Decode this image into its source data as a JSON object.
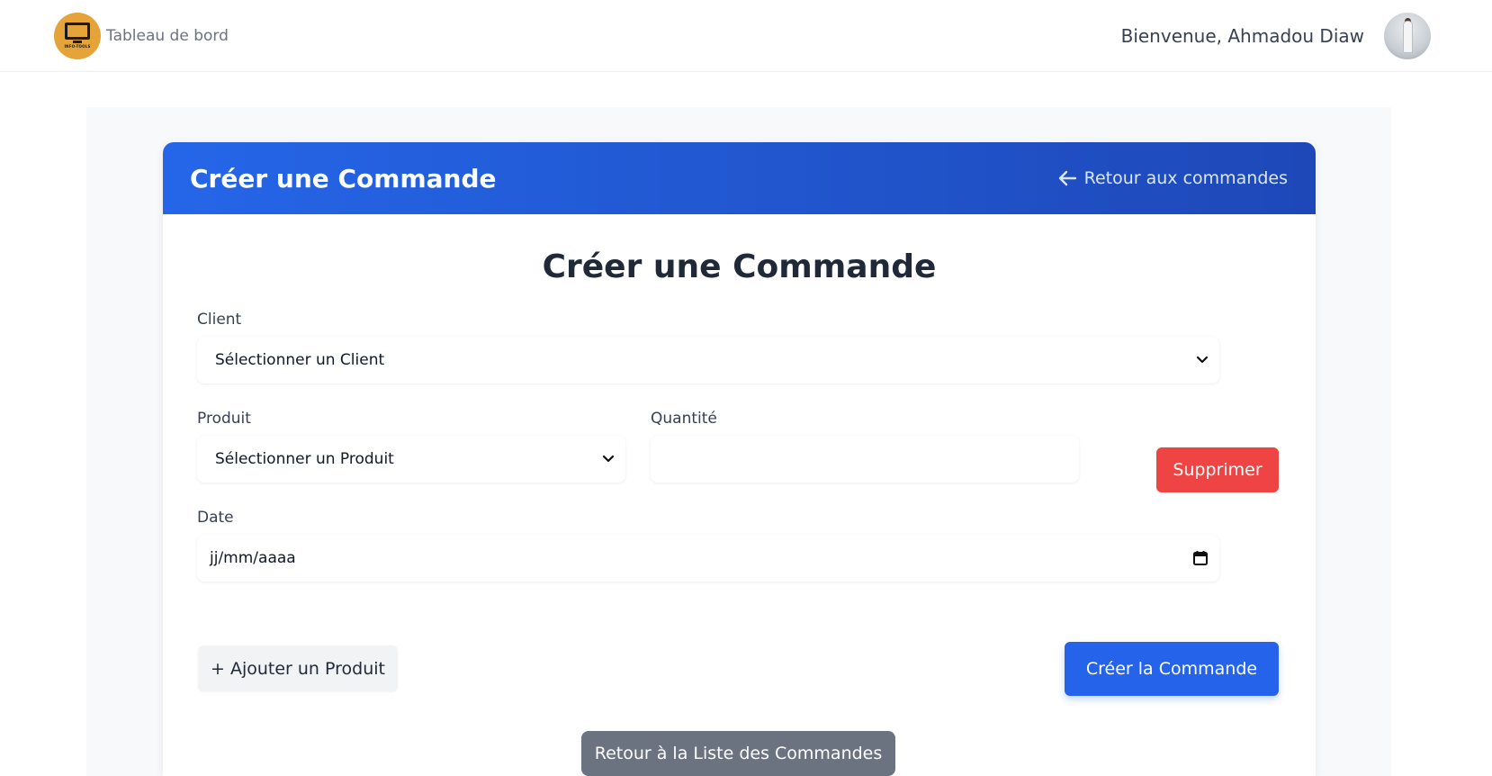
{
  "nav": {
    "brand_label": "Tableau de bord",
    "logo_text": "INFO-TOOLS",
    "welcome_text": "Bienvenue, Ahmadou Diaw",
    "logo_color": "#e5a43a"
  },
  "card_header": {
    "title": "Créer une Commande",
    "back_link_label": "Retour aux commandes",
    "gradient_start": "#2566e8",
    "gradient_end": "#1e48b8"
  },
  "form": {
    "title": "Créer une Commande",
    "client": {
      "label": "Client",
      "selected": "Sélectionner un Client"
    },
    "product": {
      "label": "Produit",
      "selected": "Sélectionner un Produit"
    },
    "quantity": {
      "label": "Quantité",
      "value": ""
    },
    "delete_button": "Supprimer",
    "date": {
      "label": "Date",
      "placeholder": "jj/mm/aaaa"
    },
    "add_product_button": "+ Ajouter un Produit",
    "submit_button": "Créer la Commande",
    "back_to_list_button": "Retour à la Liste des Commandes"
  },
  "colors": {
    "primary": "#2563eb",
    "danger": "#ef4444",
    "secondary": "#6b7280"
  }
}
